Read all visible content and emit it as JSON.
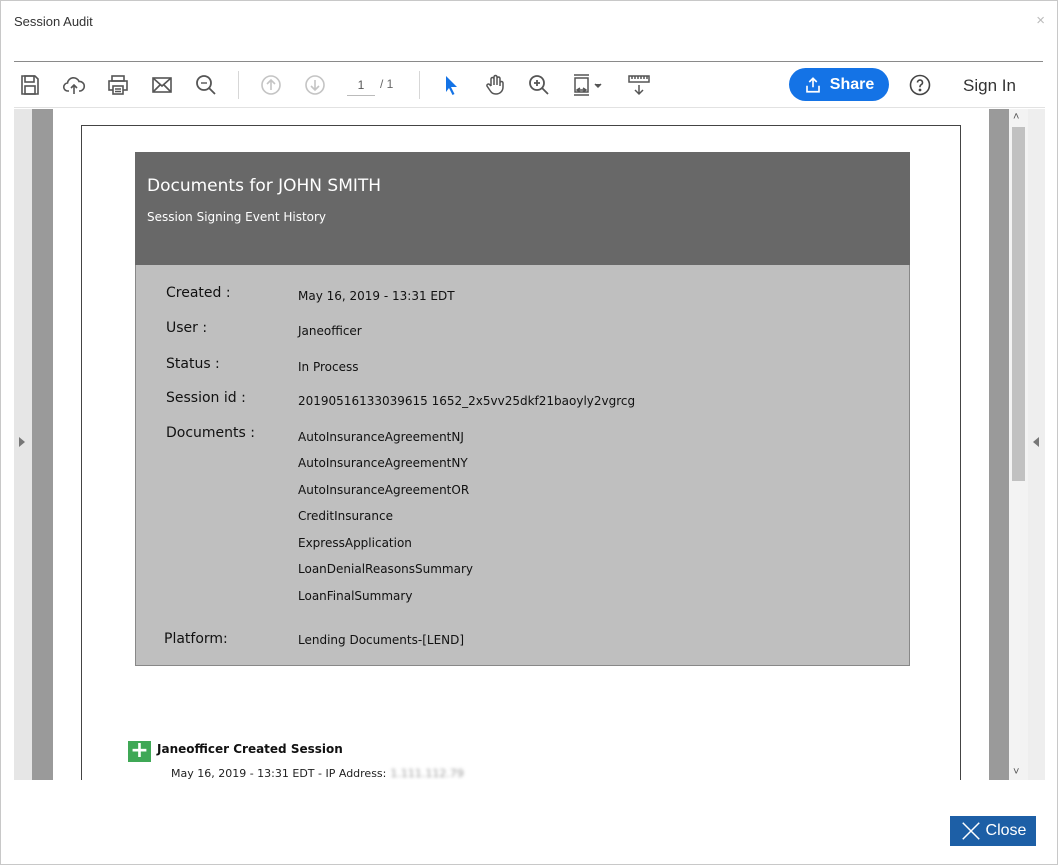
{
  "dialog": {
    "title": "Session Audit",
    "close_glyph": "×"
  },
  "toolbar": {
    "page_current": "1",
    "page_total": "/ 1",
    "share_label": "Share",
    "signin_label": "Sign In"
  },
  "document": {
    "title": "Documents for JOHN SMITH",
    "subtitle": "Session Signing Event History",
    "fields": {
      "created_label": "Created :",
      "created_value": "May 16, 2019 - 13:31  EDT",
      "user_label": "User :",
      "user_value": "Janeofficer",
      "status_label": "Status :",
      "status_value": "In Process",
      "session_label": "Session id :",
      "session_value": "20190516133039615 1652_2x5vv25dkf21baoyly2vgrcg",
      "documents_label": "Documents :",
      "platform_label": "Platform:",
      "platform_value": "Lending Documents-[LEND]"
    },
    "documents": [
      "AutoInsuranceAgreementNJ",
      "AutoInsuranceAgreementNY",
      "AutoInsuranceAgreementOR",
      "CreditInsurance",
      "ExpressApplication",
      "LoanDenialReasonsSummary",
      "LoanFinalSummary"
    ],
    "event": {
      "icon": "+",
      "title": "Janeofficer Created Session",
      "meta": "May 16, 2019 - 13:31  EDT - IP Address:",
      "ip": "1.111.112.79"
    }
  },
  "footer": {
    "close_label": "Close"
  },
  "colors": {
    "accent": "#1473e6",
    "header_bg": "#686868",
    "info_bg": "#bfbfbf",
    "event_green": "#3fa856",
    "close_bg": "#1d5fa6"
  }
}
